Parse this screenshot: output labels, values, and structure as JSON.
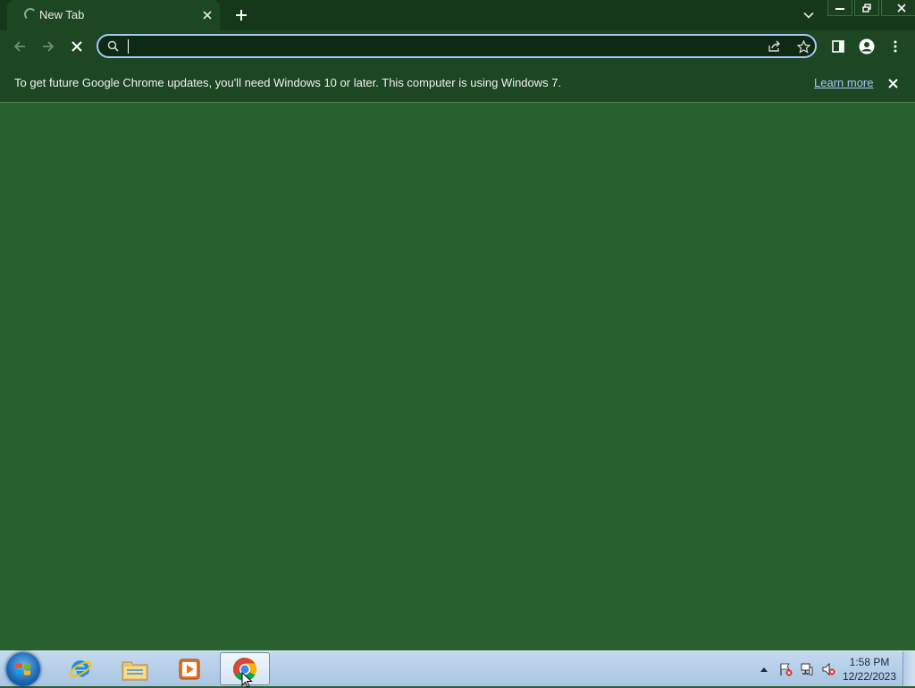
{
  "browser": {
    "tab": {
      "title": "New Tab",
      "loading": true
    },
    "omnibox": {
      "value": "",
      "placeholder": ""
    }
  },
  "infobar": {
    "message": "To get future Google Chrome updates, you'll need Windows 10 or later. This computer is using Windows 7.",
    "link": "Learn more"
  },
  "taskbar": {
    "apps": [
      "internet-explorer",
      "windows-explorer",
      "windows-media-player",
      "google-chrome"
    ],
    "active_app": "google-chrome",
    "clock": {
      "time": "1:58 PM",
      "date": "12/22/2023"
    }
  },
  "colors": {
    "page_background": "#2a6130",
    "frame": "#15381a",
    "toolbar": "#1d4622",
    "omnibox_border": "#a8c7fa",
    "link": "#a8c7fa"
  }
}
